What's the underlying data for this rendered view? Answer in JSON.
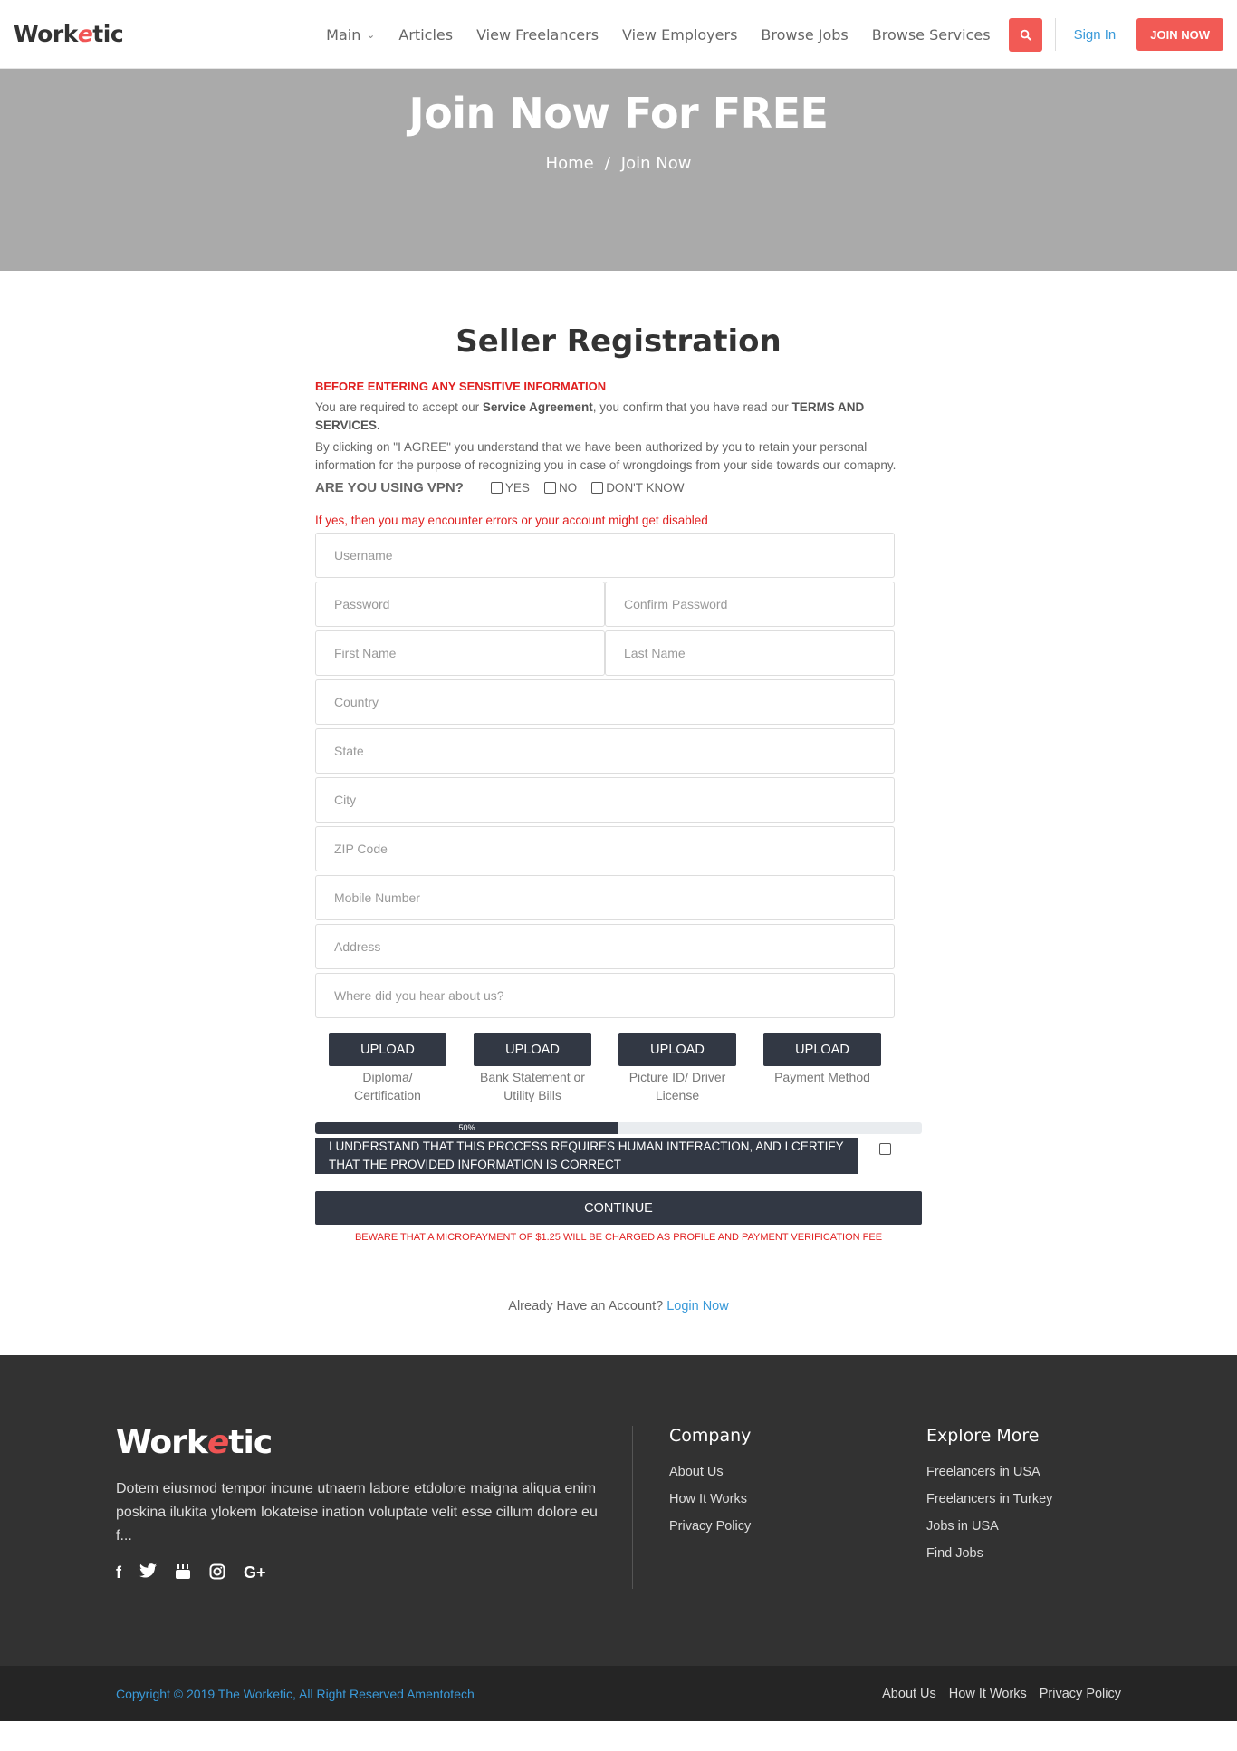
{
  "header": {
    "logo_left": "Work",
    "logo_accent": "e",
    "logo_right": "tic",
    "nav": [
      "Main",
      "Articles",
      "View Freelancers",
      "View Employers",
      "Browse Jobs",
      "Browse Services"
    ],
    "signin": "Sign In",
    "join": "JOIN NOW"
  },
  "hero": {
    "title": "Join Now For FREE",
    "crumb_home": "Home",
    "crumb_sep": "/",
    "crumb_current": "Join Now"
  },
  "form": {
    "title": "Seller Registration",
    "warn_title": "BEFORE ENTERING ANY SENSITIVE INFORMATION",
    "p1_a": "You are required to accept our ",
    "p1_b": "Service Agreement",
    "p1_c": ", you confirm that you have read our ",
    "p1_d": "TERMS AND SERVICES.",
    "p2": "By clicking on \"I AGREE\" you understand that we have been authorized by you to retain your personal information for the purpose of recognizing you in case of wrongdoings from your side towards our comapny.",
    "vpn_question": "ARE YOU USING VPN?",
    "vpn_yes": "YES",
    "vpn_no": "NO",
    "vpn_dk": "DON'T KNOW",
    "vpn_note": "If yes, then you may encounter errors or your account might get disabled",
    "placeholders": {
      "username": "Username",
      "password": "Password",
      "confirm_password": "Confirm Password",
      "first_name": "First Name",
      "last_name": "Last Name",
      "country": "Country",
      "state": "State",
      "city": "City",
      "zip": "ZIP Code",
      "mobile": "Mobile Number",
      "address": "Address",
      "hear": "Where did you hear about us?"
    },
    "uploads": [
      {
        "button": "UPLOAD",
        "label": "Diploma/ Certification"
      },
      {
        "button": "UPLOAD",
        "label": "Bank Statement or Utility Bills"
      },
      {
        "button": "UPLOAD",
        "label": "Picture ID/ Driver License"
      },
      {
        "button": "UPLOAD",
        "label": "Payment Method"
      }
    ],
    "progress": {
      "value": 50,
      "label": "50%"
    },
    "certify": "I UNDERSTAND THAT THIS PROCESS REQUIRES HUMAN INTERACTION, AND I CERTIFY THAT THE PROVIDED INFORMATION IS CORRECT",
    "continue": "CONTINUE",
    "micro": "BEWARE THAT A MICROPAYMENT OF $1.25 WILL BE CHARGED AS PROFILE AND PAYMENT VERIFICATION FEE",
    "already": "Already Have an Account?",
    "login": "Login Now"
  },
  "footer": {
    "desc": "Dotem eiusmod tempor incune utnaem labore etdolore maigna aliqua enim poskina ilukita ylokem lokateise ination voluptate velit esse cillum dolore eu f...",
    "socials": [
      "facebook-icon",
      "twitter-icon",
      "youtube-icon",
      "instagram-icon",
      "google-plus-icon"
    ],
    "company_title": "Company",
    "company_links": [
      "About Us",
      "How It Works",
      "Privacy Policy"
    ],
    "explore_title": "Explore More",
    "explore_links": [
      "Freelancers in USA",
      "Freelancers in Turkey",
      "Jobs in USA",
      "Find Jobs"
    ],
    "copyright": "Copyright © 2019 The Worketic, All Right Reserved Amentotech",
    "bottom_links": [
      "About Us",
      "How It Works",
      "Privacy Policy"
    ]
  },
  "colors": {
    "accent": "#f25a55",
    "dark": "#323844",
    "link": "#3a9ad9",
    "warning": "#e02020"
  }
}
